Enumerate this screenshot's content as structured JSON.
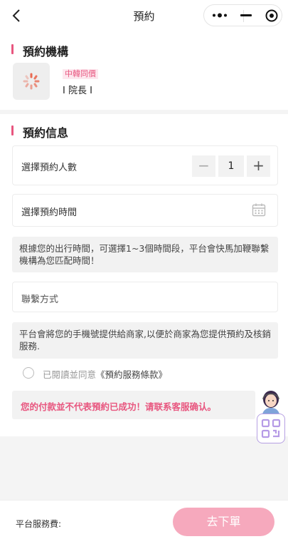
{
  "header": {
    "title": "預約"
  },
  "org_section": {
    "title": "預約機構",
    "tag": "中韓同價",
    "name": "I 院長 I"
  },
  "info_section": {
    "title": "預約信息"
  },
  "people": {
    "label": "選擇預約人數",
    "value": "1",
    "minus": "−",
    "plus": "+"
  },
  "time": {
    "label": "選擇預約時間"
  },
  "time_note": "根據您的出行時間，可選擇1~3個時間段，平台會快馬加鞭聯繫機構為您匹配時間！",
  "contact": {
    "label": "聯繫方式"
  },
  "contact_note": "平台會將您的手機號提供給商家,以便於商家為您提供預約及核銷服務.",
  "agreement": {
    "prefix": "已閱讀並同意",
    "link": "《預約服務條款》"
  },
  "warning": "您的付款並不代表預約已成功！请联系客服确认。",
  "footer": {
    "fee_label": "平台服務費:",
    "submit_label": "去下單"
  },
  "colors": {
    "accent": "#e8567f",
    "submit_bg": "#f6a9bd"
  }
}
